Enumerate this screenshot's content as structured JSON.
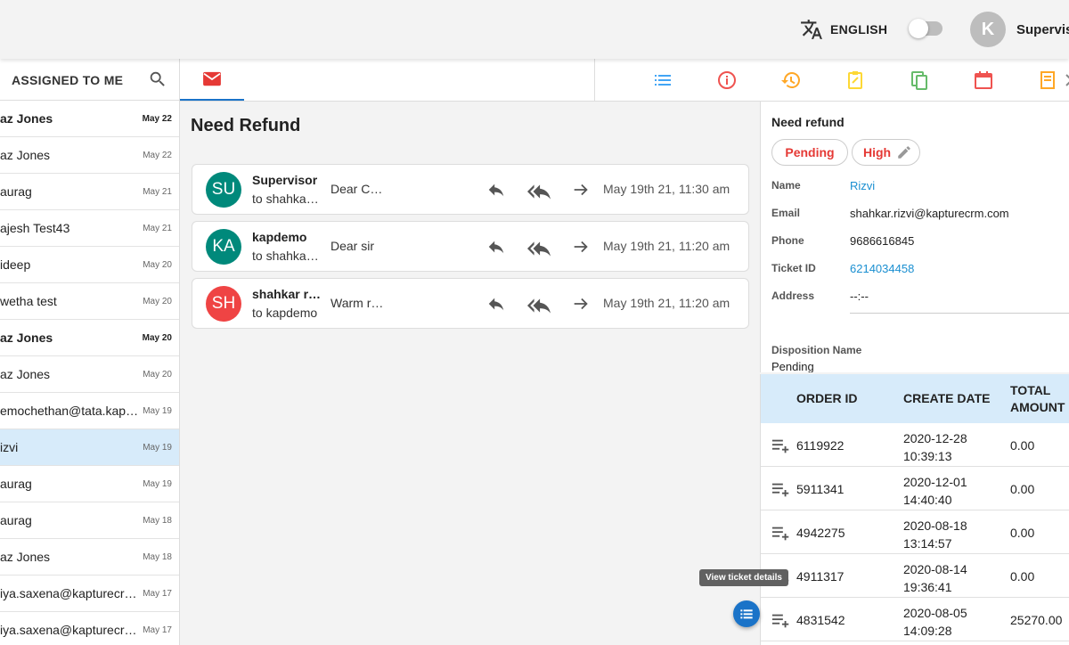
{
  "header": {
    "language_label": "ENGLISH",
    "avatar_initial": "K",
    "username": "Supervis"
  },
  "left_panel": {
    "title": "ASSIGNED TO ME",
    "items": [
      {
        "name": "az Jones",
        "date": "May 22",
        "bold": true
      },
      {
        "name": "az Jones",
        "date": "May 22",
        "bold": false
      },
      {
        "name": "aurag",
        "date": "May 21",
        "bold": false
      },
      {
        "name": "ajesh Test43",
        "date": "May 21",
        "bold": false
      },
      {
        "name": "ideep",
        "date": "May 20",
        "bold": false
      },
      {
        "name": "wetha test",
        "date": "May 20",
        "bold": false
      },
      {
        "name": "az Jones",
        "date": "May 20",
        "bold": true
      },
      {
        "name": "az Jones",
        "date": "May 20",
        "bold": false
      },
      {
        "name": "emochethan@tata.kapturecrm.com",
        "date": "May 19",
        "bold": false
      },
      {
        "name": "izvi",
        "date": "May 19",
        "bold": false,
        "selected": true
      },
      {
        "name": "aurag",
        "date": "May 19",
        "bold": false
      },
      {
        "name": "aurag",
        "date": "May 18",
        "bold": false
      },
      {
        "name": "az Jones",
        "date": "May 18",
        "bold": false
      },
      {
        "name": "iya.saxena@kapturecrm.com",
        "date": "May 17",
        "bold": false
      },
      {
        "name": "iya.saxena@kapturecrm.com",
        "date": "May 17",
        "bold": false
      }
    ]
  },
  "conversation": {
    "title": "Need Refund",
    "threads": [
      {
        "initials": "SU",
        "color": "#00897b",
        "from": "Supervisor",
        "to": "to shahkar.rizvi",
        "snippet": "Dear Customer",
        "time": "May 19th 21, 11:30 am"
      },
      {
        "initials": "KA",
        "color": "#00897b",
        "from": "kapdemo",
        "to": "to shahkar.rizvi",
        "snippet": "Dear sir",
        "time": "May 19th 21, 11:20 am"
      },
      {
        "initials": "SH",
        "color": "#ef4444",
        "from": "shahkar rizvi",
        "to": "to kapdemo",
        "snippet": "Warm regards",
        "time": "May 19th 21, 11:20 am"
      }
    ]
  },
  "details": {
    "title": "Need refund",
    "status_chip": "Pending",
    "priority_chip": "High",
    "fields": [
      {
        "label": "Name",
        "value": "Rizvi",
        "link": true
      },
      {
        "label": "Email",
        "value": "shahkar.rizvi@kapturecrm.com",
        "link": false
      },
      {
        "label": "Phone",
        "value": "9686616845",
        "link": false
      },
      {
        "label": "Ticket ID",
        "value": "6214034458",
        "link": true
      },
      {
        "label": "Address",
        "value": "--:--",
        "link": false
      }
    ],
    "disposition_label": "Disposition Name",
    "disposition_value": "Pending"
  },
  "orders": {
    "headers": {
      "order_id": "ORDER ID",
      "create_date": "CREATE DATE",
      "total_amount_1": "TOTAL",
      "total_amount_2": "AMOUNT"
    },
    "rows": [
      {
        "id": "6119922",
        "date": "2020-12-28",
        "time": "10:39:13",
        "amount": "0.00"
      },
      {
        "id": "5911341",
        "date": "2020-12-01",
        "time": "14:40:40",
        "amount": "0.00"
      },
      {
        "id": "4942275",
        "date": "2020-08-18",
        "time": "13:14:57",
        "amount": "0.00"
      },
      {
        "id": "4911317",
        "date": "2020-08-14",
        "time": "19:36:41",
        "amount": "0.00"
      },
      {
        "id": "4831542",
        "date": "2020-08-05",
        "time": "14:09:28",
        "amount": "25270.00"
      }
    ]
  },
  "tooltip": "View ticket details",
  "colors": {
    "accent": "#1a73c8",
    "selected_row": "#d7ebfa",
    "danger": "#e53935",
    "link": "#1a8fd1"
  }
}
